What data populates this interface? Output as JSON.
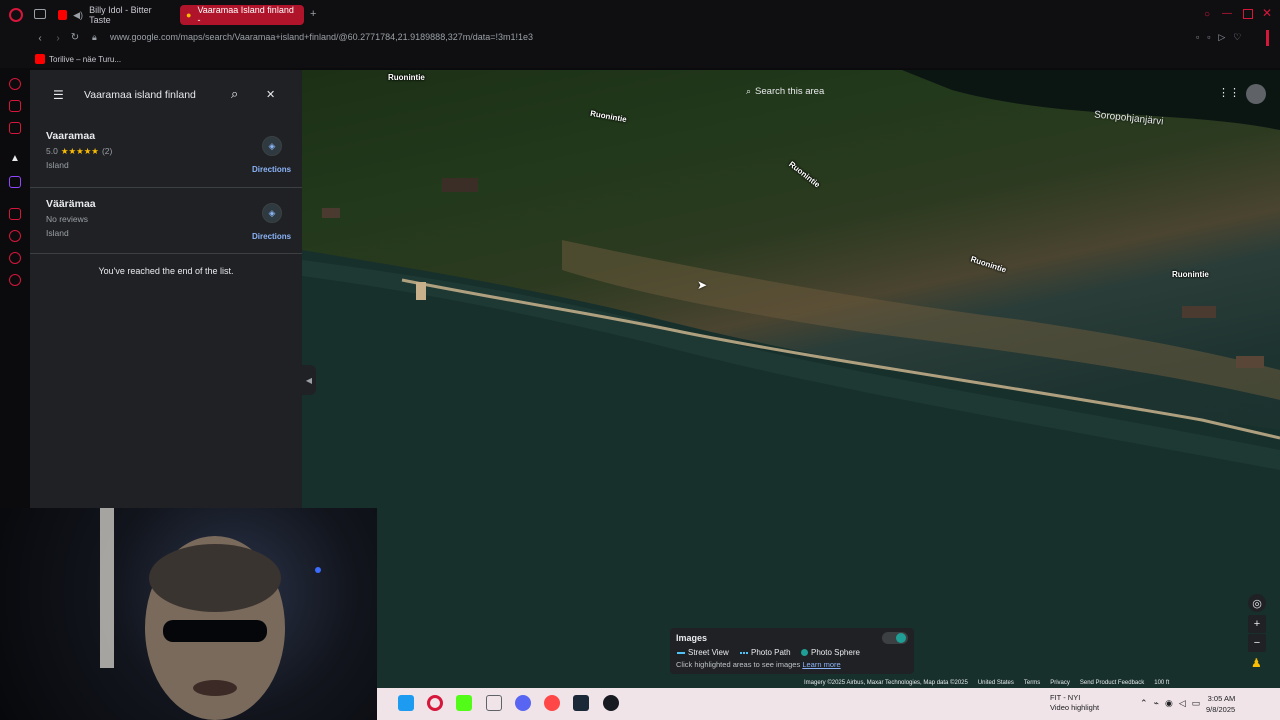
{
  "browser": {
    "tabs": [
      {
        "label": "Billy Idol - Bitter Taste",
        "active": false
      },
      {
        "label": "Vaaramaa Island finland -",
        "active": true
      }
    ],
    "url": "www.google.com/maps/search/Vaaramaa+island+finland/@60.2771784,21.9189888,327m/data=!3m1!1e3",
    "bookmarks": [
      {
        "label": "Torilive – näe Turu..."
      }
    ]
  },
  "maps": {
    "search": {
      "value": "Vaaramaa island finland"
    },
    "results": [
      {
        "title": "Vaaramaa",
        "rating": "5.0",
        "stars": "★★★★★",
        "reviews": "(2)",
        "type": "Island",
        "directions": "Directions"
      },
      {
        "title": "Väärämaa",
        "rating_text": "No reviews",
        "type": "Island",
        "directions": "Directions"
      }
    ],
    "end_of_list": "You've reached the end of the list.",
    "search_this_area": "Search this area",
    "map_labels": {
      "road_1": "Ruonintie",
      "road_2": "Ruonintie",
      "road_3": "Ruonintie",
      "road_4": "Ruonintie",
      "road_5": "Ruonintie",
      "lake": "Soropohjanjärvi"
    },
    "layers": {
      "title": "Images",
      "legend": [
        "Street View",
        "Photo Path",
        "Photo Sphere"
      ],
      "hint": "Click highlighted areas to see images",
      "learn_more": "Learn more",
      "colors": {
        "street_view": "#4fc3f7",
        "photo_sphere": "#1e9e94"
      }
    },
    "attribution": {
      "imagery": "Imagery ©2025 Airbus, Maxar Technologies, Map data ©2025",
      "country": "United States",
      "terms": "Terms",
      "privacy": "Privacy",
      "feedback": "Send Product Feedback",
      "scale": "100 ft"
    }
  },
  "taskbar": {
    "notice_line1": "FIT - NYI",
    "notice_line2": "Video highlight",
    "time": "3:05 AM",
    "date": "9/8/2025"
  },
  "theme": {
    "accent": "#d6163b",
    "maps_blue": "#8ab4f8"
  }
}
